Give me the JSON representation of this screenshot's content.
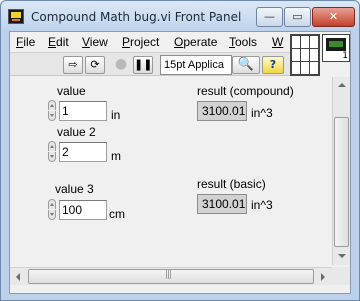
{
  "window": {
    "title": "Compound Math bug.vi Front Panel",
    "controls": {
      "minimize": "—",
      "maximize": "▭",
      "close": "✕"
    }
  },
  "menu": [
    "File",
    "Edit",
    "View",
    "Project",
    "Operate",
    "Tools",
    "W"
  ],
  "toolbar": {
    "run_icon": "run-arrow-icon",
    "run_continuous_icon": "run-continuously-icon",
    "abort_icon": "abort-icon",
    "pause_icon": "pause-icon",
    "font_select": "15pt Applica",
    "search_icon": "search-icon",
    "help_icon": "help-icon",
    "help_symbol": "?"
  },
  "vi_icon": {
    "sub": "1"
  },
  "panel": {
    "value1": {
      "label": "value",
      "value": "1",
      "unit": "in"
    },
    "value2": {
      "label": "value 2",
      "value": "2",
      "unit": "m"
    },
    "value3": {
      "label": "value 3",
      "value": "100",
      "unit": "cm"
    },
    "result_compound": {
      "label": "result (compound)",
      "value": "3100.01",
      "unit": "in^3"
    },
    "result_basic": {
      "label": "result (basic)",
      "value": "3100.01",
      "unit": "in^3"
    }
  },
  "colors": {
    "help_yellow": "#f0d744",
    "close_red": "#c4402b",
    "indicator_gray": "#d2d2d2"
  }
}
